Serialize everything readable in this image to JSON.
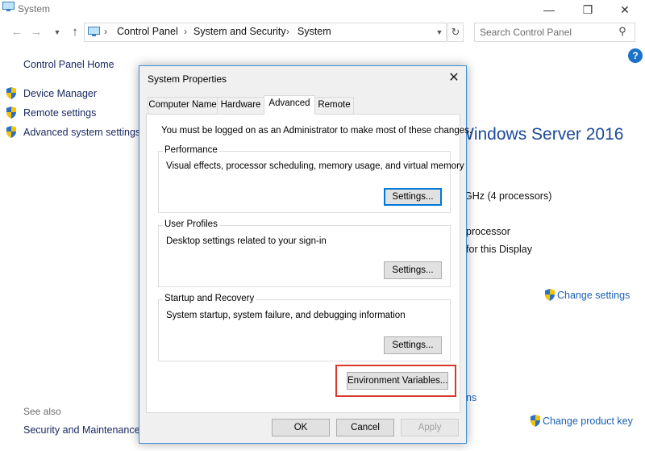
{
  "window": {
    "title": "System",
    "minimize_icon": "minimize-icon",
    "maximize_icon": "maximize-icon",
    "close_icon": "close-icon"
  },
  "nav": {
    "back_icon": "back-arrow-icon",
    "forward_icon": "forward-arrow-icon",
    "up_icon": "up-arrow-icon",
    "breadcrumb": [
      "Control Panel",
      "System and Security",
      "System"
    ],
    "search_placeholder": "Search Control Panel"
  },
  "left_pane": {
    "home": "Control Panel Home",
    "items": [
      "Device Manager",
      "Remote settings",
      "Advanced system settings"
    ],
    "see_also": "See also",
    "see_also_items": [
      "Security and Maintenance"
    ]
  },
  "background": {
    "edition": "Windows Server 2016",
    "processor": "GHz  (4 processors)",
    "system_type": "processor",
    "pen_touch": "for this Display",
    "change_settings": "Change settings",
    "activation_link_fragment": "ns",
    "change_product_key": "Change product key"
  },
  "dialog": {
    "title": "System Properties",
    "tabs": [
      {
        "label": "Computer Name",
        "active": false
      },
      {
        "label": "Hardware",
        "active": false
      },
      {
        "label": "Advanced",
        "active": true
      },
      {
        "label": "Remote",
        "active": false
      }
    ],
    "admin_message": "You must be logged on as an Administrator to make most of these changes.",
    "performance": {
      "label": "Performance",
      "desc": "Visual effects, processor scheduling, memory usage, and virtual memory",
      "button": "Settings..."
    },
    "user_profiles": {
      "label": "User Profiles",
      "desc": "Desktop settings related to your sign-in",
      "button": "Settings..."
    },
    "startup_recovery": {
      "label": "Startup and Recovery",
      "desc": "System startup, system failure, and debugging information",
      "button": "Settings..."
    },
    "env_button": "Environment Variables...",
    "ok": "OK",
    "cancel": "Cancel",
    "apply": "Apply"
  },
  "colors": {
    "highlight": "#d9382b",
    "link": "#1a5fb4",
    "accent": "#0078d7"
  }
}
